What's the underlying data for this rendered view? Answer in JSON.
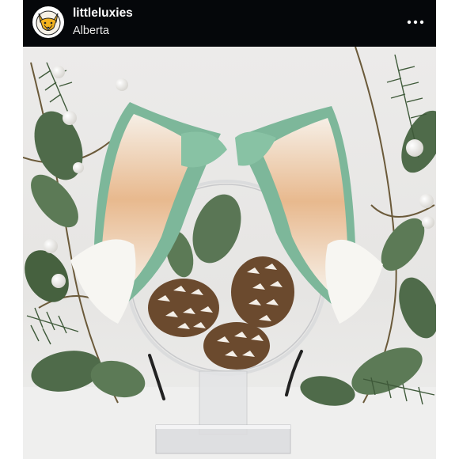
{
  "post": {
    "username": "littleluxies",
    "location": "Alberta"
  },
  "icons": {
    "avatar": "fox-logo-icon",
    "more": "more-options-icon"
  },
  "colors": {
    "header_bg": "#05070a",
    "username": "#ffffff",
    "avatar_bg": "#ffffff",
    "avatar_accent": "#f2b21e"
  },
  "photo": {
    "subject": "mint-green-and-white-faux-fur-cat-ears-headband-on-acrylic-stand"
  }
}
